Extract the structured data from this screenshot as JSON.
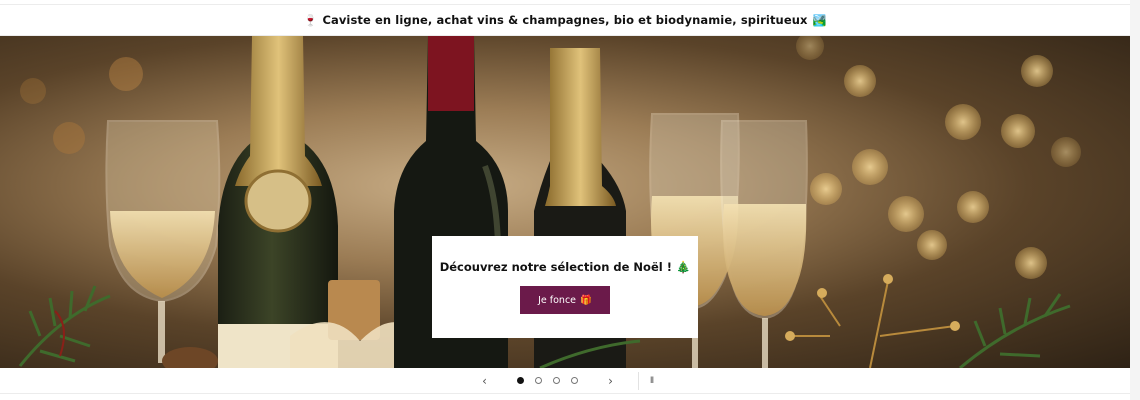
{
  "announcement": {
    "emoji_left": "🍷",
    "text": "Caviste en ligne, achat vins & champagnes, bio et biodynamie, spiritueux",
    "emoji_right": "🏞️"
  },
  "hero": {
    "image_icon": "wine-bottles-glasses-christmas-image",
    "promo": {
      "title": "Découvrez notre sélection de Noël !",
      "title_emoji": "🎄",
      "button_label": "Je fonce",
      "button_emoji": "🎁"
    },
    "colors": {
      "button_bg": "#6b1a4a",
      "box_bg": "#ffffff"
    }
  },
  "slider": {
    "prev_label": "‹",
    "next_label": "›",
    "pause_label": "II",
    "slides_count": 4,
    "active_slide": 1
  }
}
